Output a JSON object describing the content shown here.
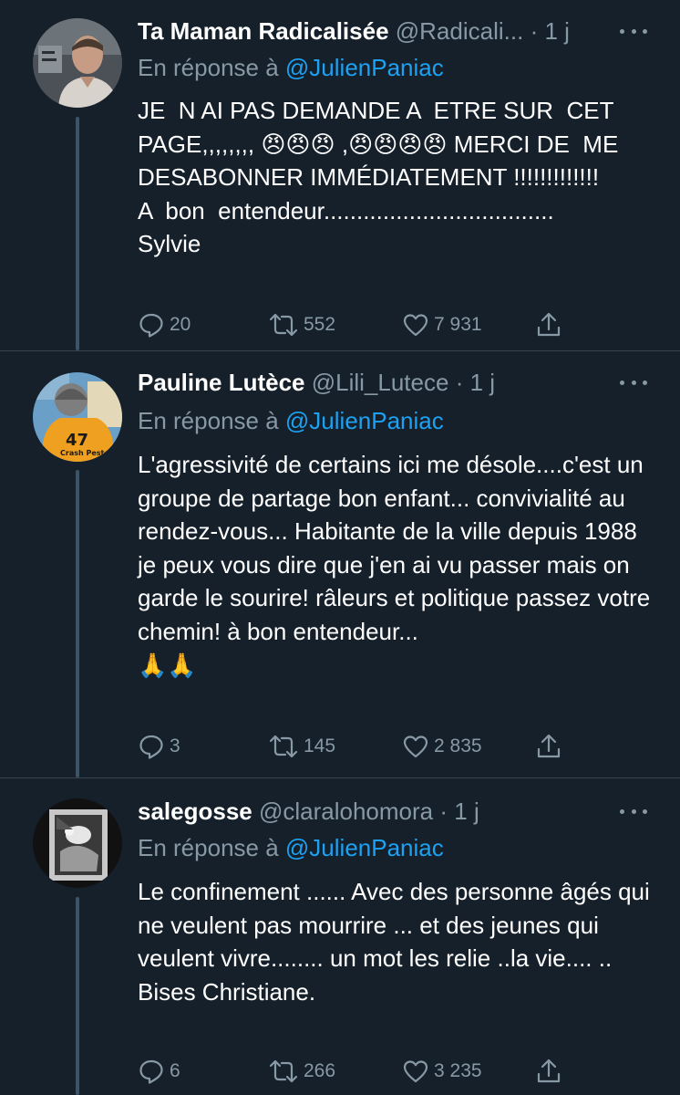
{
  "tweets": [
    {
      "display_name": "Ta Maman Radicalisée",
      "handle": "@Radicali...",
      "separator": "·",
      "time": "1 j",
      "reply_prefix": "En réponse à",
      "reply_mention": "@JulienPaniac",
      "text": "JE  N AI PAS DEMANDE A  ETRE SUR  CET PAGE,,,,,,,, 😠😠😠 ,😠😠😠😠 MERCI DE  ME  DESABONNER IMMÉDIATEMENT !!!!!!!!!!!!!\nA  bon  entendeur...................................\nSylvie",
      "replies": "20",
      "retweets": "552",
      "likes": "7 931",
      "avatar_icon": "man-portrait-avatar"
    },
    {
      "display_name": "Pauline Lutèce",
      "handle": "@Lili_Lutece",
      "separator": "·",
      "time": "1 j",
      "reply_prefix": "En réponse à",
      "reply_mention": "@JulienPaniac",
      "text": "L'agressivité de certains ici me désole....c'est un groupe de partage bon enfant... convivialité au rendez-vous... Habitante de la ville depuis 1988 je peux vous dire que j'en ai vu passer mais on garde le sourire! râleurs et politique passez votre chemin! à bon entendeur...\n🙏🙏",
      "replies": "3",
      "retweets": "145",
      "likes": "2 835",
      "avatar_icon": "roller-derby-avatar",
      "avatar_text": {
        "number": "47",
        "team": "Crash Peste"
      }
    },
    {
      "display_name": "salegosse",
      "handle": "@claralohomora",
      "separator": "·",
      "time": "1 j",
      "reply_prefix": "En réponse à",
      "reply_mention": "@JulienPaniac",
      "text": "Le confinement ...... Avec des personne âgés qui ne veulent pas mourrire ... et des jeunes qui veulent vivre........ un mot les relie ..la vie.... ..\nBises Christiane.",
      "replies": "6",
      "retweets": "266",
      "likes": "3 235",
      "avatar_icon": "black-and-white-photo-avatar"
    }
  ],
  "icons": {
    "reply": "reply-icon",
    "retweet": "retweet-icon",
    "like": "heart-icon",
    "share": "share-icon",
    "more": "more-icon"
  },
  "colors": {
    "background": "#15202b",
    "divider": "#38444d",
    "primary_text": "#ffffff",
    "secondary_text": "#8899a6",
    "link": "#1da1f2"
  }
}
